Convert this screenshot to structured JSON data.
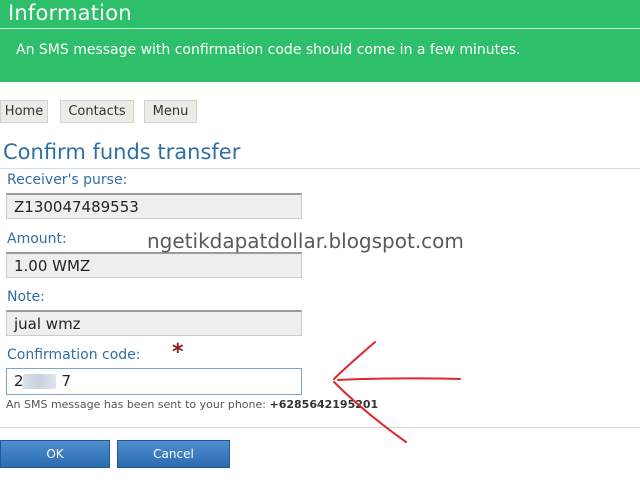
{
  "info": {
    "title": "Information",
    "message": "An SMS message with confirmation code should come in a few minutes."
  },
  "nav": {
    "home": "Home",
    "contacts": "Contacts",
    "menu": "Menu"
  },
  "page_title": "Confirm funds transfer",
  "form": {
    "receiver_label": "Receiver's purse:",
    "receiver_value": "Z130047489553",
    "amount_label": "Amount:",
    "amount_value": "1.00 WMZ",
    "note_label": "Note:",
    "note_value": "jual wmz",
    "code_label": "Confirmation code:",
    "code_required": "*",
    "code_prefix": "2",
    "code_suffix": "7",
    "sms_note": "An SMS message has been sent to your phone:",
    "phone": "+6285642195201"
  },
  "buttons": {
    "ok": "OK",
    "cancel": "Cancel"
  },
  "watermark": "ngetikdapatdollar.blogspot.com",
  "colors": {
    "info_bg": "#2ebf6a",
    "label_blue": "#2f6fa2",
    "button_blue": "#3a7cc0",
    "annotation_red": "#e0262b"
  },
  "icons": [
    "red-arrow-annotation"
  ]
}
